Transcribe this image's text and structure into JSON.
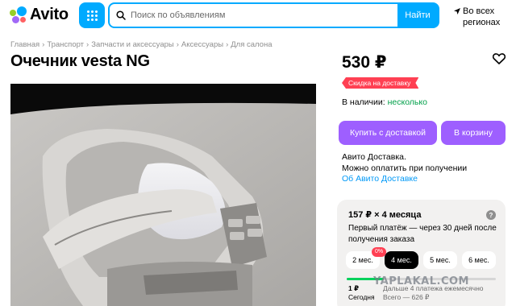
{
  "header": {
    "logo_text": "Avito",
    "search_placeholder": "Поиск по объявлениям",
    "search_button": "Найти",
    "region_line1": "Во всех",
    "region_line2": "регионах"
  },
  "breadcrumb": [
    "Главная",
    "Транспорт",
    "Запчасти и аксессуары",
    "Аксессуары",
    "Для салона"
  ],
  "breadcrumb_separator": "›",
  "listing": {
    "title": "Очечник vesta NG",
    "price": "530 ₽",
    "discount_badge": "Скидка на доставку",
    "stock_label": "В наличии:",
    "stock_value": "несколько"
  },
  "actions": {
    "buy_delivery": "Купить с доставкой",
    "add_to_cart": "В корзину"
  },
  "delivery": {
    "line1": "Авито Доставка.",
    "line2": "Можно оплатить при получении",
    "link": "Об Авито Доставке"
  },
  "installment": {
    "title": "157 ₽ × 4 месяца",
    "help": "?",
    "description": "Первый платёж — через 30 дней после получения заказа",
    "percent_badge": "0%",
    "terms": [
      "2 мес.",
      "4 мес.",
      "5 мес.",
      "6 мес."
    ],
    "selected_term": "4 мес.",
    "first_payment_progress": 0.25,
    "first_amount": "1 ₽",
    "first_when": "Сегодня",
    "rest_line1": "Дальше 4 платежа ежемесячно",
    "rest_line2": "Всего — 626 ₽"
  },
  "watermark": "YAPLAKAL.COM",
  "colors": {
    "brand_blue": "#00aaff",
    "purple": "#9e5fff",
    "discount_red": "#ff4053",
    "stock_green": "#02a04a",
    "link_blue": "#0099f7"
  }
}
